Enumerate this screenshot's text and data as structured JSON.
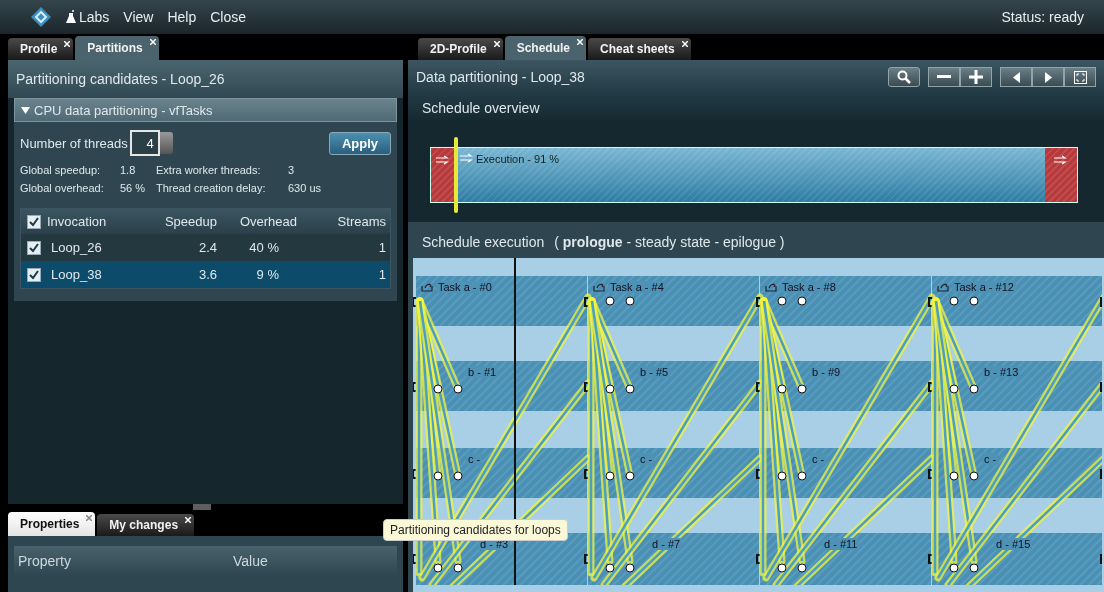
{
  "menubar": {
    "items": [
      "Labs",
      "View",
      "Help",
      "Close"
    ],
    "status": "Status: ready"
  },
  "left_panel": {
    "tabs": [
      {
        "label": "Profile",
        "selected": false
      },
      {
        "label": "Partitions",
        "selected": true
      }
    ],
    "title": "Partitioning candidates - Loop_26",
    "section": {
      "title": "CPU data partitioning - vfTasks",
      "expanded": true
    },
    "threads": {
      "label": "Number of threads",
      "value": "4"
    },
    "apply": "Apply",
    "stats": [
      {
        "label": "Global speedup:",
        "value": "1.8"
      },
      {
        "label": "Extra worker threads:",
        "value": "3"
      },
      {
        "label": "Global overhead:",
        "value": "56 %"
      },
      {
        "label": "Thread creation delay:",
        "value": "630 us"
      }
    ],
    "table": {
      "header_checked": true,
      "columns": [
        "Invocation",
        "Speedup",
        "Overhead",
        "Streams"
      ],
      "rows": [
        {
          "checked": true,
          "selected": false,
          "cells": [
            "Loop_26",
            "2.4",
            "40 %",
            "1"
          ]
        },
        {
          "checked": true,
          "selected": true,
          "cells": [
            "Loop_38",
            "3.6",
            "9 %",
            "1"
          ]
        }
      ]
    }
  },
  "bottom_panel": {
    "tabs": [
      {
        "label": "Properties",
        "selected": true
      },
      {
        "label": "My changes",
        "selected": false
      }
    ],
    "columns": [
      "Property",
      "Value"
    ]
  },
  "right_panel": {
    "tabs": [
      {
        "label": "2D-Profile",
        "selected": false
      },
      {
        "label": "Schedule",
        "selected": true
      },
      {
        "label": "Cheat sheets",
        "selected": false
      }
    ],
    "title": "Data partitioning - Loop_38",
    "overview_title": "Schedule overview",
    "overview": {
      "label": "Execution - 91 %"
    },
    "execution_title": "Schedule execution",
    "phases": "( **prologue** -  steady state -  epilogue )",
    "timeline": {
      "rows": [
        {
          "tasks": [
            "Task a - #0",
            "Task a - #4",
            "Task a - #8",
            "Task a - #12"
          ]
        },
        {
          "tasks": [
            "b - #1",
            "b - #5",
            "b - #9",
            "b - #13"
          ]
        },
        {
          "tasks": [
            "c -",
            "c -",
            "c -",
            "c -"
          ]
        },
        {
          "tasks": [
            "d - #3",
            "d - #7",
            "d - #11",
            "d - #15"
          ]
        }
      ]
    }
  },
  "tooltip": "Partitioning candidates for loops"
}
